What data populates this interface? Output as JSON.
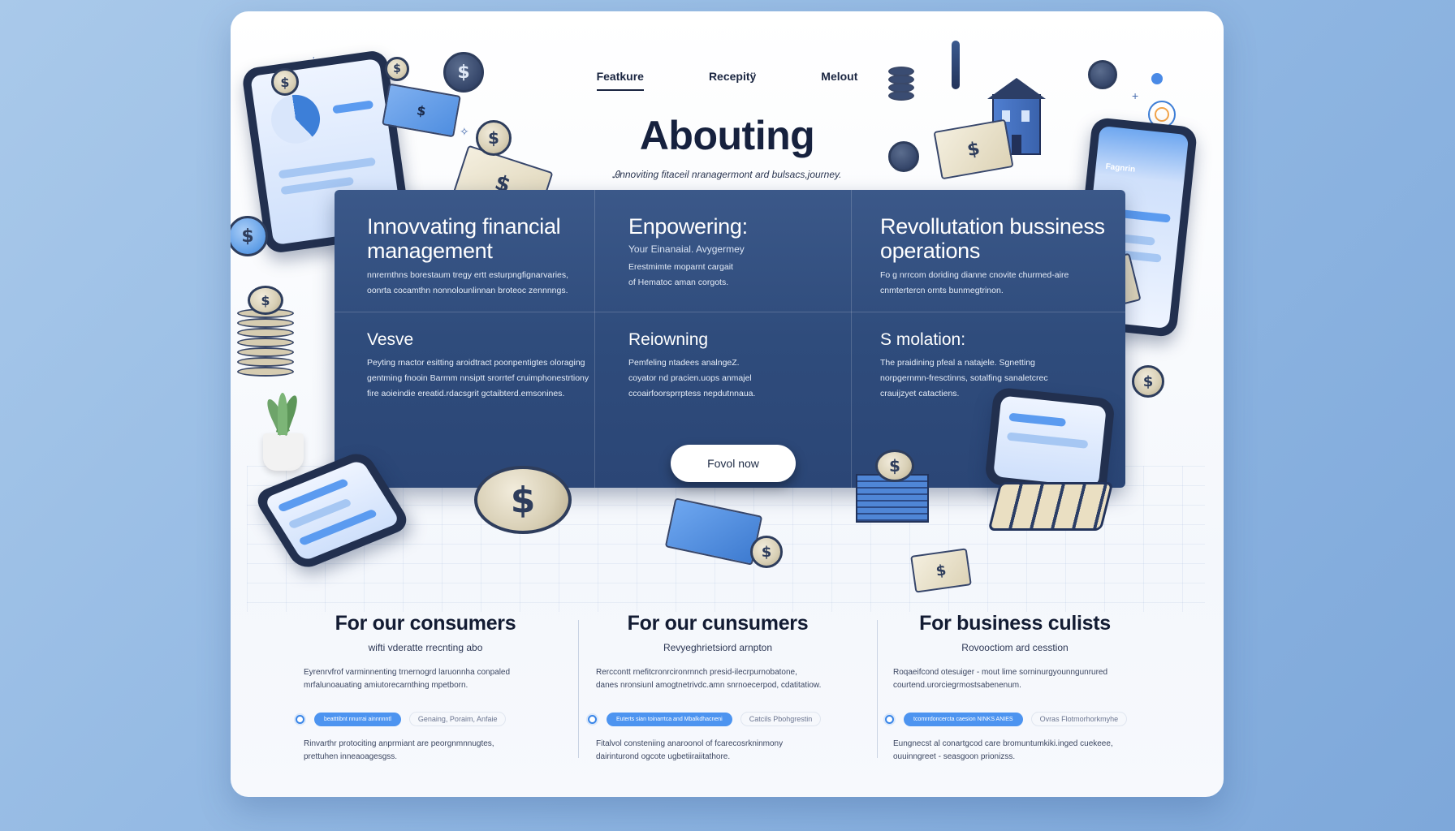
{
  "nav": {
    "items": [
      {
        "label": "Featkure",
        "active": true
      },
      {
        "label": "Recepitÿ",
        "active": false
      },
      {
        "label": "Melout",
        "active": false
      }
    ]
  },
  "hero": {
    "title": "Abouting",
    "subtitle": "Ꭿnnoviting fitaceil nranagermont ard bulsacs,journey."
  },
  "panel": {
    "cells": [
      {
        "title": "Innovvating financial management",
        "text": "nnrernthns borestaum tregy ertt esturpngfignarvaries,\noonrta cocamthn nonnolounlinnan broteoc zennnngs."
      },
      {
        "title": "Enpowering:",
        "subtitle": "Your Einanaial. Avygermey",
        "text": "Erestmimte moparnt cargait\nof Hematoc aman corgots."
      },
      {
        "title": "Revollutation bussiness operations",
        "text": "Fo g nrrcom doriding dianne cnovite churmed-aire\ncnmtertercn ornts bunmegtrinon."
      },
      {
        "title": "Vesve",
        "text": "Peyting rnactor esitting aroidtract poonpentigtes oloraging\ngentming fnooin Barmm nnsiptt srorrtef cruimphonestrtiony\nfire aoieindie ereatid.rdacsgrit gctaibterd.emsonines."
      },
      {
        "title": "Reiowning",
        "text": "Pemfeling ntadees analngeZ.\ncoyator nd pracien.uops anmajel\nccoairfoorsprrptess nepdutnnaua."
      },
      {
        "title": "S molation:",
        "text": "The praidining pfeal a natajele. Sgnetting\nnorpgernmn-fresctinns, sotalfing sanaletcrec\ncrauijzyet catactiens."
      }
    ],
    "button_label": "Fovol now"
  },
  "columns": [
    {
      "heading": "For our consumers",
      "lead": "wifti vderatte rrecnting abo",
      "desc": "Eyrenrvfrof varminnenting trnernogrd laruonnha conpaled\nmrfalunoauating amiutorecarnthing mpetborn.",
      "pill": "beatttibnt nnurrai ainnnnntl",
      "ghost": "Genaing,  Poraim,  Anfaie",
      "desc2": "Rinvarthr protociting anprmiant are peorgnmnnugtes,\nprettuhen inneaoagesgss."
    },
    {
      "heading": "For our cunsumers",
      "lead": "Revyeghrietsiord arnpton",
      "desc": "Rerccontt rnefitcronrcironrnnch presid-ilecrpurnobatone,\ndanes nronsiunl amogtnetrivdc.amn snrnoecerpod, cdatitatiow.",
      "pill": "Euterts sian toinarrtca and Mbalkdhacneni",
      "ghost": "Catcils   Pbohgrestin",
      "desc2": "Fitalvol consteniing anaroonol of fcarecosrkninmony\ndairinturond ogcote ugbetiiraiitathore."
    },
    {
      "heading": "For business culists",
      "lead": "Rovooctiom ard cesstion",
      "desc": "Roqaeifcond otesuiger - mout lime sorninurgyounngunrured\ncourtend.urorciegrmostsabenenum.",
      "pill": "tcomrrdoncercta caesion NINKS ANIES",
      "ghost": "Ovras  Flotmorhorkmyhe",
      "desc2": "Eungnecst al conartgcod care bromuntumkiki.inged cuekeee,\nouuinngreet - seasgoon prionizss."
    }
  ],
  "decor": {
    "coin_symbol": "$",
    "device_label": "Fagnrin"
  }
}
